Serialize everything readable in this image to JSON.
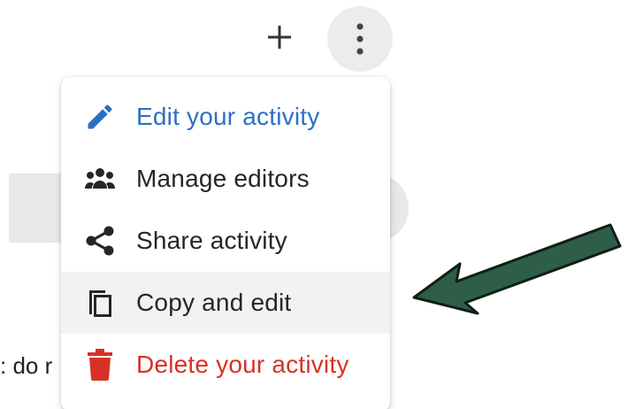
{
  "background": {
    "partial_text": ": do r"
  },
  "toolbar": {
    "add_icon": "plus-icon",
    "more_icon": "more-vertical-icon"
  },
  "menu": {
    "items": [
      {
        "label": "Edit your activity",
        "icon": "pencil-icon",
        "color": "#2d6fc4"
      },
      {
        "label": "Manage editors",
        "icon": "people-icon",
        "color": "#262626"
      },
      {
        "label": "Share activity",
        "icon": "share-icon",
        "color": "#262626"
      },
      {
        "label": "Copy and edit",
        "icon": "copy-icon",
        "color": "#262626",
        "hovered": true
      },
      {
        "label": "Delete your activity",
        "icon": "trash-icon",
        "color": "#d93025"
      }
    ]
  },
  "annotation": {
    "arrow_color": "#2f5e48",
    "arrow_stroke": "#0d1f16",
    "points_to": "Copy and edit"
  }
}
